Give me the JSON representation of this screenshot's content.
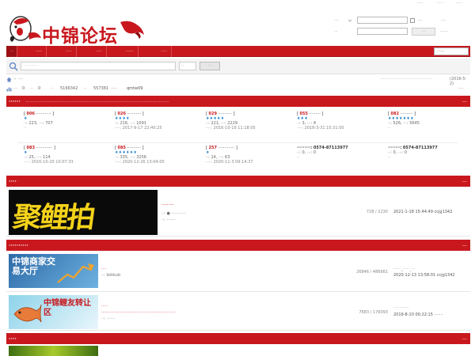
{
  "topbar": {
    "link1": "·····",
    "link2": "·····",
    "link3": "·····"
  },
  "logo": {
    "text": "中锦论坛"
  },
  "login": {
    "user_label": "····",
    "pass_label": "···",
    "remember_label": "····",
    "forgot_label": "····",
    "quick_label": "······",
    "login_button": "···",
    "register_label": "······"
  },
  "nav": {
    "items": [
      "··",
      "·····",
      "·····",
      "·····",
      "······",
      "·····"
    ],
    "select": "······"
  },
  "search": {
    "placeholder": "············",
    "scope": "··",
    "button": "··"
  },
  "breadcrumb": {
    "sep": "›",
    "label": "····",
    "right_text": "··········································",
    "date": "(2016-5-2)"
  },
  "stats": {
    "t1": "··",
    "v1": "0",
    "t2": "··",
    "v2": "0",
    "t3": "··",
    "v3": "5166342",
    "t4": "··",
    "v4": "557381",
    "t5": "·····",
    "member": "qmtw09",
    "right": "····"
  },
  "cat1": {
    "title": "······",
    "announce": "··················································································································",
    "toggle": "—"
  },
  "cells": [
    {
      "num": "006",
      "name": "············",
      "gems": "♦",
      "l1": "··: 223, ···: 707",
      "l2": "··"
    },
    {
      "num": "026",
      "name": "···········",
      "gems": "♦♦♦♦",
      "l1": "··: 216, ···: 1091",
      "l2": "····: 2017-9-17 22:40:25"
    },
    {
      "num": "029",
      "name": "···········",
      "gems": "♦♦♦♦♦",
      "l1": "··: 221, ···: 2229",
      "l2": "····: 2016-10-19 11:18:05"
    },
    {
      "num": "055",
      "name": "·········",
      "gems": "♦♦♦",
      "l1": "··: 3, ···: 4",
      "l2": "····: 2018-3-31 15:31:00"
    },
    {
      "num": "082",
      "name": "··········",
      "gems": "♦♦♦♦♦♦♦",
      "l1": "··: 526, ···: 5645",
      "l2": "··"
    },
    {
      "num": "083",
      "name": "·············",
      "gems": "♦",
      "l1": "··: 25, ···: 114",
      "l2": "····: 2016-10-20 10:07:33"
    },
    {
      "num": "085",
      "name": "···········",
      "gems": "♦♦♦♦♦♦",
      "l1": "··: 335, ···: 3256",
      "l2": "····: 2020-12-26 13:04:05"
    },
    {
      "num": "257",
      "name": "·············",
      "gems": "♦",
      "l1": "··: 14, ···: 63",
      "l2": "····: 2020-11-3 09:14:37"
    },
    {
      "num": "",
      "name": "·········: 0574-87113977",
      "gems": "",
      "l1": "··: 0, ···: 0",
      "l2": "··"
    },
    {
      "num": "",
      "name": "········: 0574-87113977",
      "gems": "",
      "l1": "··: 0, ···: 0",
      "l2": "··"
    }
  ],
  "cat2": {
    "title": "····",
    "toggle": "—"
  },
  "forum1": {
    "banner": "聚鲤拍",
    "title": "·······",
    "sub1": "··: ● ············",
    "sub2": "··: ·······",
    "count": "728 / 2230",
    "last": "2021-1-18 15:44:49 ccjg1342"
  },
  "cat3": {
    "title": "··········",
    "toggle": "—"
  },
  "forum2": {
    "banner": "中锦商家交易大厅",
    "title": "····",
    "sub1": "··: kokkub",
    "count": "26846 / 486661",
    "last_title": "······_·····_···",
    "last": "2020-12-13 13:58:01 ccjg1342"
  },
  "forum3": {
    "banner": "中锦鲤友转让区",
    "title": "·····",
    "sub1": "···························································",
    "sub2": "··: ·······",
    "count": "7683 / 176093",
    "last_title": "············",
    "last": "2019-8-10 00:22:15 ·······"
  },
  "cat4": {
    "title": "····",
    "toggle": "—"
  },
  "colors": {
    "brand": "#c8181e",
    "gem": "#3a8fd6"
  }
}
